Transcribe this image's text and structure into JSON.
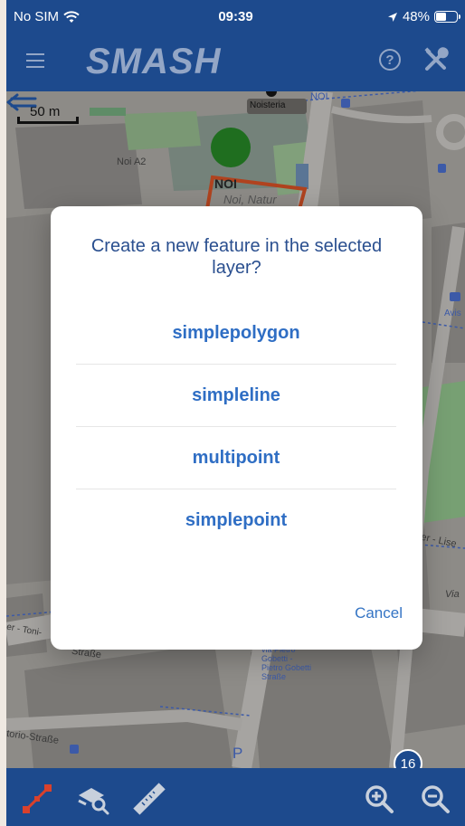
{
  "status_bar": {
    "carrier": "No SIM",
    "time": "09:39",
    "battery": "48%",
    "battery_level": 0.48
  },
  "app_bar": {
    "title": "SMASH",
    "help_icon_glyph": "?"
  },
  "map": {
    "scale_label": "50 m",
    "labels": [
      "Noisteria",
      "NOI",
      "Noi A2",
      "NOI",
      "Noi, Natur",
      "Avis",
      "via Pietro Gobetti - Pietro Gobetti Straße",
      "Straße",
      "torio-Straße",
      "er - Toni-",
      "ner - Lise",
      "Via"
    ],
    "zoom_level": "16"
  },
  "dialog": {
    "title": "Create a new feature in the selected layer?",
    "options": [
      "simplepolygon",
      "simpleline",
      "multipoint",
      "simplepoint"
    ],
    "cancel_label": "Cancel"
  },
  "bottom_bar": {
    "icons": [
      "edit-geometry-icon",
      "layer-query-icon",
      "ruler-icon",
      "zoom-in-icon",
      "zoom-out-icon"
    ]
  },
  "colors": {
    "bar_blue": "#1d4a8d",
    "accent_blue": "#2f6ec4",
    "edit_red": "#d9412c"
  }
}
